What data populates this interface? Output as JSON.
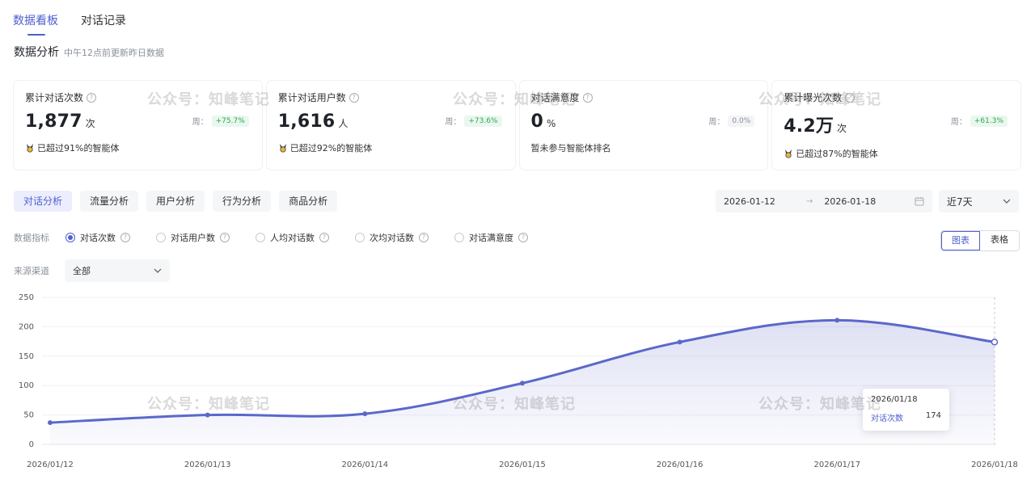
{
  "tabs": [
    {
      "label": "数据看板",
      "active": true
    },
    {
      "label": "对话记录",
      "active": false
    }
  ],
  "section": {
    "title": "数据分析",
    "subtitle": "中午12点前更新昨日数据"
  },
  "cards": [
    {
      "label": "累计对话次数",
      "value": "1,877",
      "unit": "次",
      "week_label": "周：",
      "change": "+75.7%",
      "change_type": "up",
      "footer": "已超过91%的智能体",
      "icon": "medal-icon"
    },
    {
      "label": "累计对话用户数",
      "value": "1,616",
      "unit": "人",
      "week_label": "周：",
      "change": "+73.6%",
      "change_type": "up",
      "footer": "已超过92%的智能体",
      "icon": "medal-icon"
    },
    {
      "label": "对话满意度",
      "value": "0",
      "unit": "%",
      "week_label": "周：",
      "change": "0.0%",
      "change_type": "flat",
      "footer": "暂未参与智能体排名",
      "icon": ""
    },
    {
      "label": "累计曝光次数",
      "value": "4.2万",
      "unit": "次",
      "week_label": "周：",
      "change": "+61.3%",
      "change_type": "up",
      "footer": "已超过87%的智能体",
      "icon": "medal-icon"
    }
  ],
  "subtabs": [
    {
      "label": "对话分析",
      "active": true
    },
    {
      "label": "流量分析",
      "active": false
    },
    {
      "label": "用户分析",
      "active": false
    },
    {
      "label": "行为分析",
      "active": false
    },
    {
      "label": "商品分析",
      "active": false
    }
  ],
  "date_range": {
    "start": "2026-01-12",
    "arrow": "→",
    "end": "2026-01-18"
  },
  "range_select": {
    "value": "近7天"
  },
  "metrics": {
    "label": "数据指标",
    "options": [
      {
        "label": "对话次数",
        "checked": true
      },
      {
        "label": "对话用户数",
        "checked": false
      },
      {
        "label": "人均对话数",
        "checked": false
      },
      {
        "label": "次均对话数",
        "checked": false
      },
      {
        "label": "对话满意度",
        "checked": false
      }
    ]
  },
  "view_toggle": {
    "chart": "图表",
    "table": "表格"
  },
  "source": {
    "label": "来源渠道",
    "value": "全部"
  },
  "chart_data": {
    "type": "area",
    "x": [
      "2026/01/12",
      "2026/01/13",
      "2026/01/14",
      "2026/01/15",
      "2026/01/16",
      "2026/01/17",
      "2026/01/18"
    ],
    "series": [
      {
        "name": "对话次数",
        "values": [
          37,
          50,
          52,
          104,
          174,
          211,
          174
        ]
      }
    ],
    "y_ticks": [
      0,
      50,
      100,
      150,
      200,
      250
    ],
    "ylim": [
      0,
      250
    ],
    "grid": true,
    "color": "#5b68c9"
  },
  "tooltip": {
    "date": "2026/01/18",
    "key": "对话次数",
    "value": "174"
  },
  "watermark": "公众号：知峰笔记"
}
